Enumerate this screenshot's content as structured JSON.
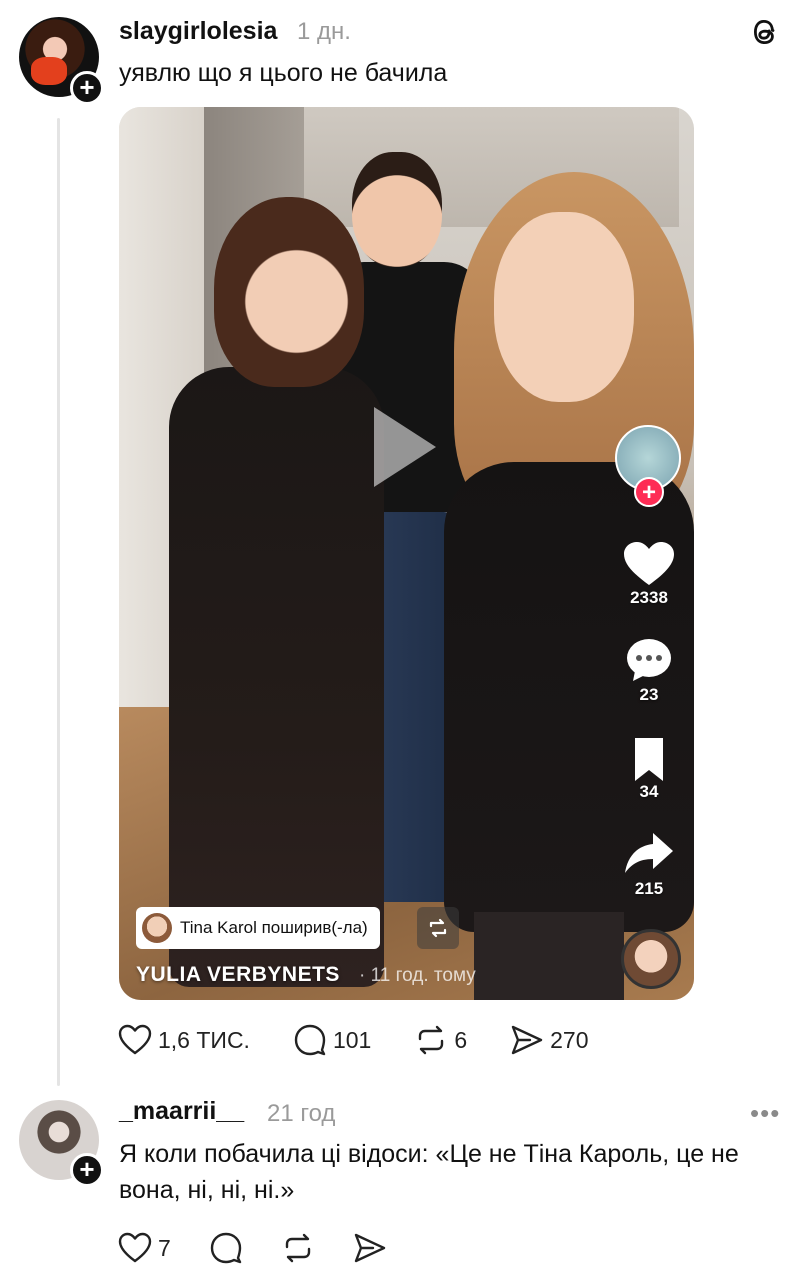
{
  "post": {
    "username": "slaygirlolesia",
    "time": "1 дн.",
    "text": "уявлю що я цього не бачила",
    "icons": {
      "app": "threads-logo-icon",
      "follow": "plus-icon"
    }
  },
  "embed": {
    "shared_by": "Tina Karol поширив(-ла)",
    "author": "YULIA VERBYNETS",
    "time": "· 11 год. тому",
    "likes": "2338",
    "comments": "23",
    "saves": "34",
    "shares": "215",
    "accent": "#fe2c55"
  },
  "post_actions": {
    "likes": "1,6 ТИС.",
    "comments": "101",
    "reposts": "6",
    "shares": "270"
  },
  "reply": {
    "username": "_maarrii__",
    "time": "21 год",
    "text": "Я коли побачила ці відоси: «Це не Тіна Кароль, це не вона, ні, ні, ні.»",
    "likes": "7",
    "more": "•••"
  }
}
